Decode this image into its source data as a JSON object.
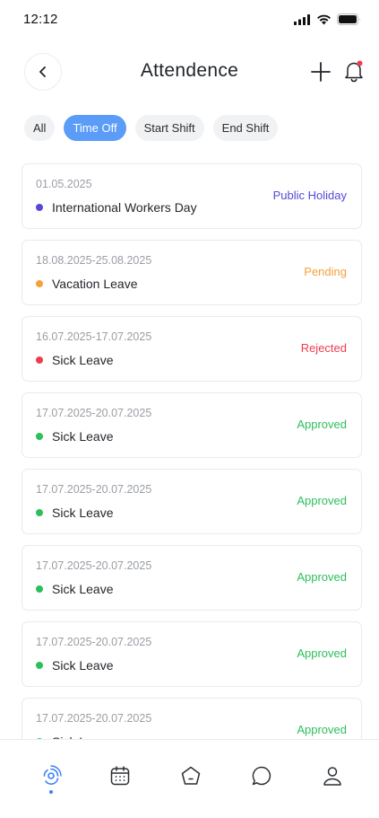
{
  "status_bar": {
    "time": "12:12"
  },
  "header": {
    "title": "Attendence"
  },
  "filters": [
    {
      "label": "All",
      "active": false
    },
    {
      "label": "Time Off",
      "active": true
    },
    {
      "label": "Start Shift",
      "active": false
    },
    {
      "label": "End Shift",
      "active": false
    }
  ],
  "records": [
    {
      "date": "01.05.2025",
      "type": "International Workers Day",
      "status": "Public Holiday",
      "status_color": "#5548d9",
      "dot_color": "#5548d9"
    },
    {
      "date": "18.08.2025-25.08.2025",
      "type": "Vacation Leave",
      "status": "Pending",
      "status_color": "#f5a13d",
      "dot_color": "#f5a13d"
    },
    {
      "date": "16.07.2025-17.07.2025",
      "type": "Sick Leave",
      "status": "Rejected",
      "status_color": "#ee3d4f",
      "dot_color": "#ee3d4f"
    },
    {
      "date": "17.07.2025-20.07.2025",
      "type": "Sick Leave",
      "status": "Approved",
      "status_color": "#2cbf5a",
      "dot_color": "#2cbf5a"
    },
    {
      "date": "17.07.2025-20.07.2025",
      "type": "Sick Leave",
      "status": "Approved",
      "status_color": "#2cbf5a",
      "dot_color": "#2cbf5a"
    },
    {
      "date": "17.07.2025-20.07.2025",
      "type": "Sick Leave",
      "status": "Approved",
      "status_color": "#2cbf5a",
      "dot_color": "#2cbf5a"
    },
    {
      "date": "17.07.2025-20.07.2025",
      "type": "Sick Leave",
      "status": "Approved",
      "status_color": "#2cbf5a",
      "dot_color": "#2cbf5a"
    },
    {
      "date": "17.07.2025-20.07.2025",
      "type": "Sick Leave",
      "status": "Approved",
      "status_color": "#2cbf5a",
      "dot_color": "#2cbf5a"
    }
  ],
  "bottom_nav": [
    {
      "icon": "attendance-icon",
      "active": true
    },
    {
      "icon": "calendar-icon",
      "active": false
    },
    {
      "icon": "home-icon",
      "active": false
    },
    {
      "icon": "chat-icon",
      "active": false
    },
    {
      "icon": "profile-icon",
      "active": false
    }
  ],
  "colors": {
    "accent": "#5b9cf8",
    "nav_active": "#3a7ff6",
    "nav_inactive": "#2b2f33",
    "notification_dot": "#ee3d4f"
  }
}
